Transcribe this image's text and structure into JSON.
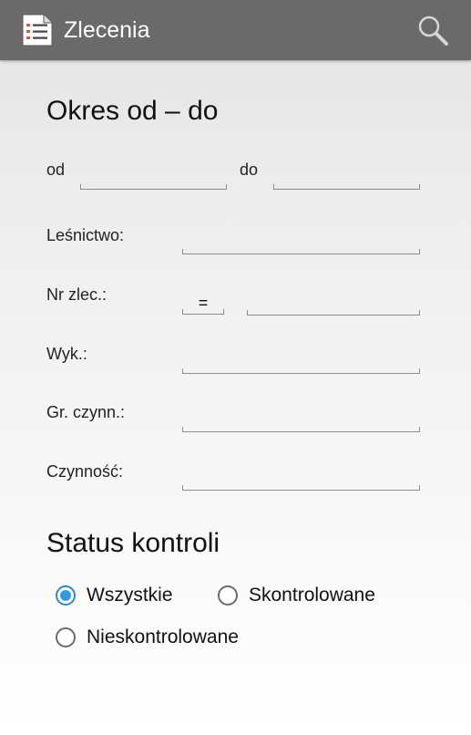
{
  "appbar": {
    "title": "Zlecenia"
  },
  "period": {
    "heading": "Okres od – do",
    "from_label": "od",
    "from_value": "",
    "to_label": "do",
    "to_value": ""
  },
  "filters": {
    "forestry_label": "Leśnictwo:",
    "forestry_value": "",
    "order_no_label": "Nr zlec.:",
    "order_no_operator": "=",
    "order_no_value": "",
    "contractor_label": "Wyk.:",
    "contractor_value": "",
    "activity_group_label": "Gr. czynn.:",
    "activity_group_value": "",
    "activity_label": "Czynność:",
    "activity_value": ""
  },
  "status": {
    "heading": "Status kontroli",
    "options": [
      {
        "label": "Wszystkie",
        "checked": true
      },
      {
        "label": "Skontrolowane",
        "checked": false
      },
      {
        "label": "Nieskontrolowane",
        "checked": false
      }
    ]
  },
  "colors": {
    "appbar": "#6a6a6a",
    "accent": "#2f9be0",
    "divider": "#8c8c8c"
  },
  "icons": {
    "app": "checklist-document-icon",
    "search": "magnifier-icon"
  }
}
